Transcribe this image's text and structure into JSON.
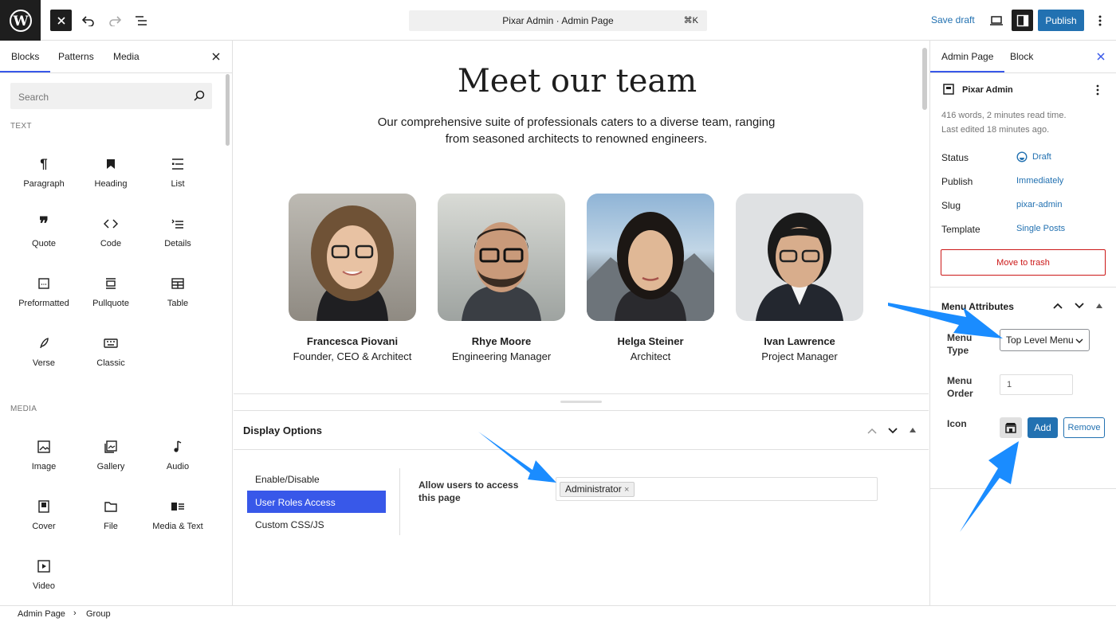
{
  "topbar": {
    "doc_title": "Pixar Admin · Admin Page",
    "shortcut": "⌘K",
    "save_draft": "Save draft",
    "publish": "Publish"
  },
  "inserter": {
    "tabs": [
      "Blocks",
      "Patterns",
      "Media"
    ],
    "search_placeholder": "Search",
    "sections": [
      "TEXT",
      "MEDIA"
    ],
    "text_blocks": [
      "Paragraph",
      "Heading",
      "List",
      "Quote",
      "Code",
      "Details",
      "Preformatted",
      "Pullquote",
      "Table",
      "Verse",
      "Classic"
    ],
    "media_blocks": [
      "Image",
      "Gallery",
      "Audio",
      "Cover",
      "File",
      "Media & Text",
      "Video"
    ]
  },
  "canvas": {
    "heading": "Meet our team",
    "lead": "Our comprehensive suite of professionals caters to a diverse team, ranging from seasoned architects to renowned engineers.",
    "team": [
      {
        "name": "Francesca Piovani",
        "role": "Founder, CEO & Architect"
      },
      {
        "name": "Rhye Moore",
        "role": "Engineering Manager"
      },
      {
        "name": "Helga Steiner",
        "role": "Architect"
      },
      {
        "name": "Ivan Lawrence",
        "role": "Project Manager"
      }
    ]
  },
  "display_options": {
    "title": "Display Options",
    "tabs": [
      "Enable/Disable",
      "User Roles Access",
      "Custom CSS/JS"
    ],
    "field_label": "Allow users to access this page",
    "tag": "Administrator",
    "tag_remove": "×"
  },
  "settings": {
    "tabs": [
      "Admin Page",
      "Block"
    ],
    "site_name": "Pixar Admin",
    "word_count": "416 words, 2 minutes read time.",
    "last_edited": "Last edited 18 minutes ago.",
    "rows": [
      {
        "label": "Status",
        "value": "Draft"
      },
      {
        "label": "Publish",
        "value": "Immediately"
      },
      {
        "label": "Slug",
        "value": "pixar-admin"
      },
      {
        "label": "Template",
        "value": "Single Posts"
      }
    ],
    "trash": "Move to trash",
    "menu_attributes": "Menu Attributes",
    "menu_type_label": "Menu Type",
    "menu_type_value": "Top Level Menu",
    "menu_order_label": "Menu Order",
    "menu_order_value": "1",
    "icon_label": "Icon",
    "add": "Add",
    "remove": "Remove"
  },
  "breadcrumb": [
    "Admin Page",
    "Group"
  ],
  "colors": {
    "accent": "#3858e9",
    "wp_blue": "#2271b1",
    "annotation_arrow": "#1a8cff"
  }
}
